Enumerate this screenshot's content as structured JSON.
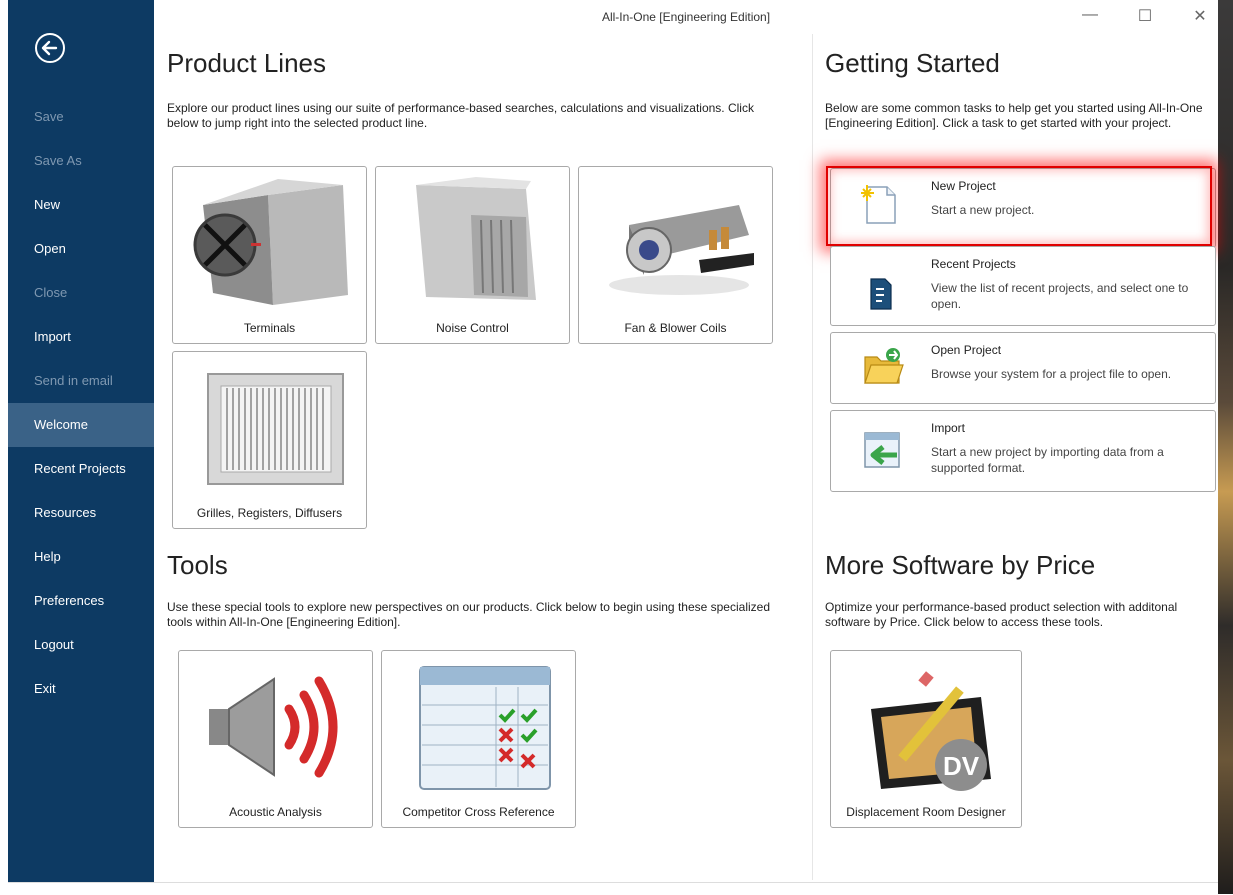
{
  "window": {
    "title": "All-In-One [Engineering Edition]",
    "minimize_glyph": "—",
    "maximize_glyph": "☐",
    "close_glyph": "✕"
  },
  "sidebar": {
    "back_icon": "back-arrow-icon",
    "items": [
      {
        "label": "Save",
        "enabled": false
      },
      {
        "label": "Save As",
        "enabled": false
      },
      {
        "label": "New",
        "enabled": true
      },
      {
        "label": "Open",
        "enabled": true
      },
      {
        "label": "Close",
        "enabled": false
      },
      {
        "label": "Import",
        "enabled": true
      },
      {
        "label": "Send in email",
        "enabled": false
      },
      {
        "label": "Welcome",
        "enabled": true,
        "selected": true
      },
      {
        "label": "Recent Projects",
        "enabled": true
      },
      {
        "label": "Resources",
        "enabled": true
      },
      {
        "label": "Help",
        "enabled": true
      },
      {
        "label": "Preferences",
        "enabled": true
      },
      {
        "label": "Logout",
        "enabled": true
      },
      {
        "label": "Exit",
        "enabled": true
      }
    ]
  },
  "product_lines": {
    "title": "Product Lines",
    "description": "Explore our product lines using our suite of performance-based searches, calculations and visualizations. Click below to jump right into the selected product line.",
    "tiles": [
      {
        "label": "Terminals",
        "icon": "terminal-unit-icon"
      },
      {
        "label": "Noise Control",
        "icon": "silencer-icon"
      },
      {
        "label": "Fan & Blower Coils",
        "icon": "fan-coil-icon"
      },
      {
        "label": "Grilles, Registers, Diffusers",
        "icon": "grille-icon"
      }
    ]
  },
  "tools": {
    "title": "Tools",
    "description": "Use these special tools to explore new perspectives on our products. Click below to begin using these specialized tools within All-In-One [Engineering Edition].",
    "tiles": [
      {
        "label": "Acoustic Analysis",
        "icon": "speaker-icon"
      },
      {
        "label": "Competitor Cross Reference",
        "icon": "checklist-icon"
      }
    ]
  },
  "getting_started": {
    "title": "Getting Started",
    "description": "Below are some common tasks to help get you started using All-In-One [Engineering Edition]. Click a task to get started with your project.",
    "tasks": [
      {
        "title": "New Project",
        "desc": "Start a new project.",
        "icon": "new-document-icon"
      },
      {
        "title": "Recent Projects",
        "desc": "View the list of recent projects, and select one to open.",
        "icon": "recent-projects-icon"
      },
      {
        "title": "Open Project",
        "desc": "Browse your system for a project file to open.",
        "icon": "open-folder-icon"
      },
      {
        "title": "Import",
        "desc": "Start a new project by importing data from a supported format.",
        "icon": "import-icon"
      }
    ]
  },
  "more_software": {
    "title": "More Software by Price",
    "description": "Optimize your performance-based product selection with additonal software by Price. Click below to access these tools.",
    "tiles": [
      {
        "label": "Displacement Room Designer",
        "icon": "displacement-room-designer-icon",
        "badge": "DV"
      }
    ]
  },
  "colors": {
    "sidebar_bg": "#0d3a63",
    "sidebar_selected": "#3a6287",
    "sidebar_disabled_text": "#7f98b1",
    "highlight": "#e00000"
  }
}
